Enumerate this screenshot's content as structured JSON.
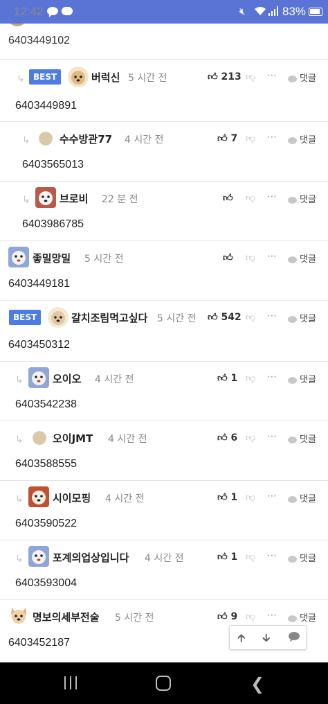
{
  "status_bar": {
    "time": "12:42",
    "battery": "83%"
  },
  "top_partial_comment": {
    "body": "6403449102"
  },
  "comments": [
    {
      "best": true,
      "nickname": "버럭신",
      "time": "5 시간 전",
      "likes": "213",
      "reply_label": "댓글",
      "body": "6403449891"
    },
    {
      "best": false,
      "nickname": "수수방관77",
      "time": "4 시간 전",
      "likes": "7",
      "reply_label": "댓글",
      "body": "6403565013"
    },
    {
      "best": false,
      "nickname": "브로비",
      "time": "22 분 전",
      "likes": "",
      "reply_label": "댓글",
      "body": "6403986785"
    },
    {
      "best": false,
      "nickname": "좋밀망밀",
      "time": "5 시간 전",
      "likes": "",
      "reply_label": "댓글",
      "body": "6403449181"
    },
    {
      "best": true,
      "nickname": "갈치조림먹고싶다",
      "time": "5 시간 전",
      "likes": "542",
      "reply_label": "댓글",
      "body": "6403450312"
    },
    {
      "best": false,
      "nickname": "오이오",
      "time": "4 시간 전",
      "likes": "1",
      "reply_label": "댓글",
      "body": "6403542238"
    },
    {
      "best": false,
      "nickname": "오이JMT",
      "time": "4 시간 전",
      "likes": "6",
      "reply_label": "댓글",
      "body": "6403588555"
    },
    {
      "best": false,
      "nickname": "시이모핑",
      "time": "4 시간 전",
      "likes": "1",
      "reply_label": "댓글",
      "body": "6403590522"
    },
    {
      "best": false,
      "nickname": "포계의업상입니다",
      "time": "4 시간 전",
      "likes": "1",
      "reply_label": "댓글",
      "body": "6403593004"
    },
    {
      "best": false,
      "nickname": "명보의세부전술",
      "time": "5 시간 전",
      "likes": "9",
      "reply_label": "댓글",
      "body": "6403452187"
    }
  ],
  "best_badge": "BEST",
  "colors": {
    "status_bar": "#5a74d6",
    "best_badge": "#4d7de3",
    "divider": "#e5e5e5"
  }
}
